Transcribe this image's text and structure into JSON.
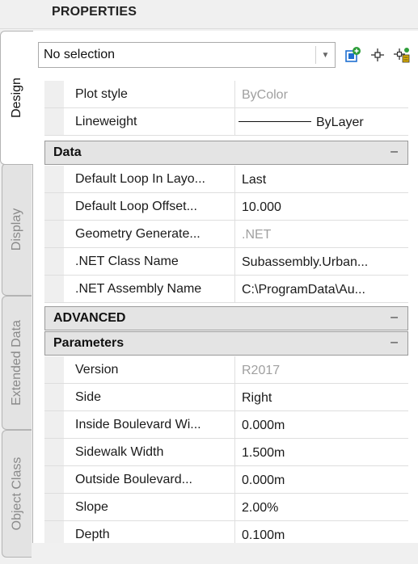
{
  "palette": {
    "title": "PROPERTIES"
  },
  "tabs": [
    {
      "label": "Design",
      "active": true
    },
    {
      "label": "Display",
      "active": false
    },
    {
      "label": "Extended Data",
      "active": false
    },
    {
      "label": "Object Class",
      "active": false
    }
  ],
  "selection": {
    "value": "No selection",
    "toolbar": [
      {
        "icon": "quick-select-icon"
      },
      {
        "icon": "select-objects-icon"
      },
      {
        "icon": "toggle-pickadd-icon"
      }
    ]
  },
  "general": {
    "plot_style": {
      "name": "Plot style",
      "value": "ByColor"
    },
    "lineweight": {
      "name": "Lineweight",
      "value": "ByLayer"
    }
  },
  "data_section": {
    "title": "Data",
    "collapse": "–",
    "rows": [
      {
        "name": "Default Loop In Layo...",
        "value": "Last"
      },
      {
        "name": "Default Loop Offset...",
        "value": "10.000"
      },
      {
        "name": "Geometry Generate...",
        "value": ".NET"
      },
      {
        "name": ".NET Class Name",
        "value": "Subassembly.Urban..."
      },
      {
        "name": ".NET Assembly Name",
        "value": "C:\\ProgramData\\Au..."
      }
    ]
  },
  "advanced_section": {
    "title": "ADVANCED",
    "collapse": "–"
  },
  "parameters_section": {
    "title": "Parameters",
    "collapse": "–",
    "rows": [
      {
        "name": "Version",
        "value": "R2017"
      },
      {
        "name": "Side",
        "value": "Right"
      },
      {
        "name": "Inside Boulevard Wi...",
        "value": "0.000m"
      },
      {
        "name": "Sidewalk Width",
        "value": "1.500m"
      },
      {
        "name": "Outside Boulevard...",
        "value": "0.000m"
      },
      {
        "name": "Slope",
        "value": "2.00%"
      },
      {
        "name": "Depth",
        "value": "0.100m"
      }
    ]
  },
  "colors": {
    "accent_green": "#2e9e3a",
    "accent_blue": "#1f6fd1",
    "accent_yellow": "#e0b000",
    "muted_text": "#a0a0a0"
  }
}
